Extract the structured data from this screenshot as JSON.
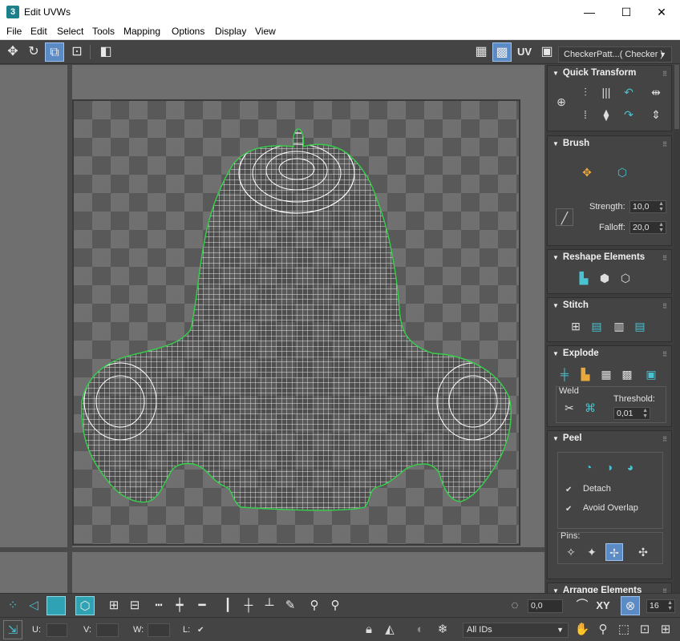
{
  "window": {
    "app_icon": "3",
    "title": "Edit UVWs",
    "min_glyph": "—",
    "max_glyph": "☐",
    "close_glyph": "✕"
  },
  "menu": [
    "File",
    "Edit",
    "Select",
    "Tools",
    "Mapping",
    "Options",
    "Display",
    "View"
  ],
  "toolbar": {
    "uv_label": "UV",
    "checker_map": "CheckerPatt...( Checker )",
    "icons": [
      "move-icon",
      "rotate-icon",
      "scale-icon",
      "freeform-icon",
      "mirror-icon",
      "checker-grid-icon",
      "checker-show-icon",
      "uv-map-icon",
      "checker-map-icon"
    ]
  },
  "colors": {
    "accent": "#49c2d1",
    "active": "#5b8bc4",
    "mesh_outline": "#35d14b",
    "mesh_wire": "#ffffff"
  },
  "panel": {
    "quick_transform": {
      "title": "Quick Transform"
    },
    "brush": {
      "title": "Brush",
      "strength_label": "Strength:",
      "strength_value": "10,0",
      "falloff_label": "Falloff:",
      "falloff_value": "20,0"
    },
    "reshape": {
      "title": "Reshape Elements"
    },
    "stitch": {
      "title": "Stitch"
    },
    "explode": {
      "title": "Explode",
      "weld_label": "Weld",
      "threshold_label": "Threshold:",
      "threshold_value": "0,01"
    },
    "peel": {
      "title": "Peel",
      "detach_label": "Detach",
      "detach_checked": true,
      "avoid_overlap_label": "Avoid Overlap",
      "avoid_overlap_checked": true,
      "pins_label": "Pins:"
    },
    "arrange": {
      "title": "Arrange Elements"
    }
  },
  "bottom": {
    "angle_value": "0,0",
    "xy_label": "XY",
    "zoom_value": "16"
  },
  "status": {
    "u_label": "U:",
    "v_label": "V:",
    "w_label": "W:",
    "l_label": "L:",
    "ids_value": "All IDs"
  }
}
